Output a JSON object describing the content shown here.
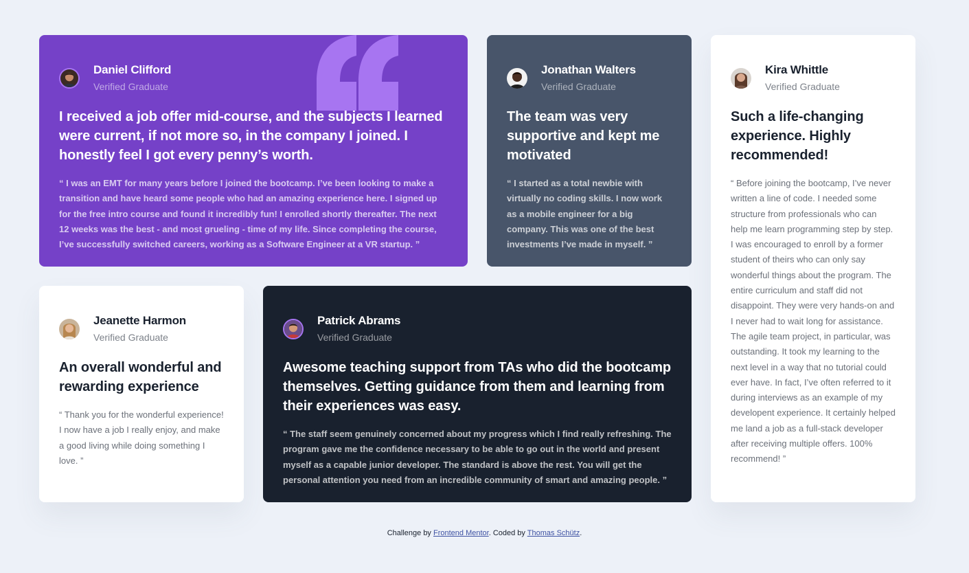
{
  "testimonials": {
    "daniel": {
      "name": "Daniel Clifford",
      "role": "Verified Graduate",
      "headline": "I received a job offer mid-course, and the subjects I learned were current, if not more so, in the company I joined. I honestly feel I got every penny’s worth.",
      "body": "“ I was an EMT for many years before I joined the bootcamp. I’ve been looking to make a transition and have heard some people who had an amazing experience here. I signed up for the free intro course and found it incredibly fun! I enrolled shortly thereafter. The next 12 weeks was the best - and most grueling - time of my life. Since completing the course, I’ve successfully switched careers, working as a Software Engineer at a VR startup. ”"
    },
    "jonathan": {
      "name": "Jonathan Walters",
      "role": "Verified Graduate",
      "headline": "The team was very supportive and kept me motivated",
      "body": "“ I started as a total newbie with virtually no coding skills. I now work as a mobile engineer for a big company. This was one of the best investments I’ve made in myself. ”"
    },
    "kira": {
      "name": "Kira Whittle",
      "role": "Verified Graduate",
      "headline": "Such a life-changing experience. Highly recommended!",
      "body": "“ Before joining the bootcamp, I’ve never written a line of code. I needed some structure from professionals who can help me learn programming step by step. I was encouraged to enroll by a former student of theirs who can only say wonderful things about the program. The entire curriculum and staff did not disappoint. They were very hands-on and I never had to wait long for assistance. The agile team project, in particular, was outstanding. It took my learning to the next level in a way that no tutorial could ever have. In fact, I’ve often referred to it during interviews as an example of my developent experience. It certainly helped me land a job as a full-stack developer after receiving multiple offers. 100% recommend! ”"
    },
    "jeanette": {
      "name": "Jeanette Harmon",
      "role": "Verified Graduate",
      "headline": "An overall wonderful and rewarding experience",
      "body": "“ Thank you for the wonderful experience! I now have a job I really enjoy, and make a good living while doing something I love. ”"
    },
    "patrick": {
      "name": "Patrick Abrams",
      "role": "Verified Graduate",
      "headline": "Awesome teaching support from TAs who did the bootcamp themselves. Getting guidance from them and learning from their experiences was easy.",
      "body": "“ The staff seem genuinely concerned about my progress which I find really refreshing. The program gave me the confidence necessary to be able to go out in the world and present myself as a capable junior developer. The standard is above the rest. You will get the personal attention you need from an incredible community of smart and amazing people. ”"
    }
  },
  "footer": {
    "prefix": "Challenge by ",
    "challenge_link": "Frontend Mentor",
    "middle": ". Coded by ",
    "author_link": "Thomas Schütz",
    "suffix": "."
  },
  "colors": {
    "purple": "#7541c8",
    "slate": "#48556a",
    "dark": "#19212e",
    "background": "#edf1f8",
    "quote_accent": "#a775f1"
  },
  "icons": {
    "quote": "quotation-mark-icon"
  }
}
